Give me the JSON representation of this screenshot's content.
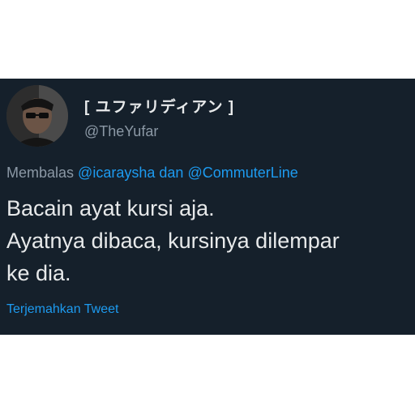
{
  "tweet": {
    "display_name": "[ ユファリディアン ]",
    "handle": "@TheYufar",
    "reply": {
      "prefix": "Membalas",
      "mention_1": "@icaraysha",
      "joiner": "dan",
      "mention_2": "@CommuterLine"
    },
    "text_lines": [
      "Bacain ayat kursi aja.",
      "Ayatnya dibaca, kursinya dilempar",
      "ke dia."
    ],
    "translate_label": "Terjemahkan Tweet"
  },
  "colors": {
    "background": "#15202b",
    "text": "#e7e9ea",
    "secondary": "#8b98a5",
    "accent": "#1d9bf0"
  }
}
